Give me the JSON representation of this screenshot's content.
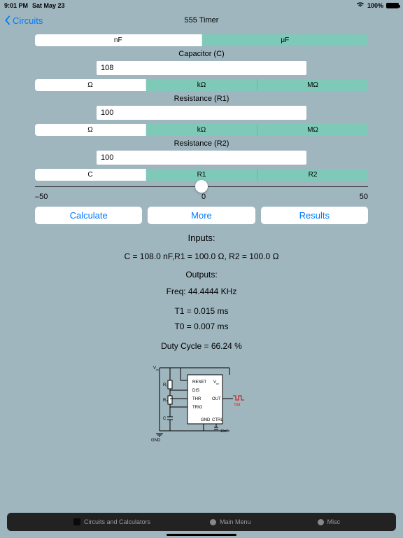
{
  "status": {
    "time": "9:01 PM",
    "date": "Sat May 23",
    "wifi": "􀙇",
    "battery_pct": "100%"
  },
  "nav": {
    "back": "Circuits",
    "title": "555 Timer"
  },
  "cap_units": {
    "opts": [
      "nF",
      "μF"
    ],
    "selected": 0
  },
  "cap_label": "Capacitor (C)",
  "cap_value": "108",
  "r1_units": {
    "opts": [
      "Ω",
      "kΩ",
      "MΩ"
    ],
    "selected": 0
  },
  "r1_label": "Resistance (R1)",
  "r1_value": "100",
  "r2_units": {
    "opts": [
      "Ω",
      "kΩ",
      "MΩ"
    ],
    "selected": 0
  },
  "r2_label": "Resistance (R2)",
  "r2_value": "100",
  "var_select": {
    "opts": [
      "C",
      "R1",
      "R2"
    ],
    "selected": 0
  },
  "slider": {
    "min": "–50",
    "mid": "0",
    "max": "50"
  },
  "buttons": {
    "calc": "Calculate",
    "more": "More",
    "results": "Results"
  },
  "output": {
    "inputs_title": "Inputs:",
    "inputs_line": "C = 108.0 nF,R1 = 100.0 Ω, R2 = 100.0 Ω",
    "outputs_title": "Outputs:",
    "freq": "Freq: 44.4444 KHz",
    "t1": "T1 = 0.015 ms",
    "t0": "T0 = 0.007 ms",
    "duty": "Duty Cycle = 66.24 %"
  },
  "tabs": {
    "a": "Circuits and Calculators",
    "b": "Main Menu",
    "c": "Misc"
  }
}
